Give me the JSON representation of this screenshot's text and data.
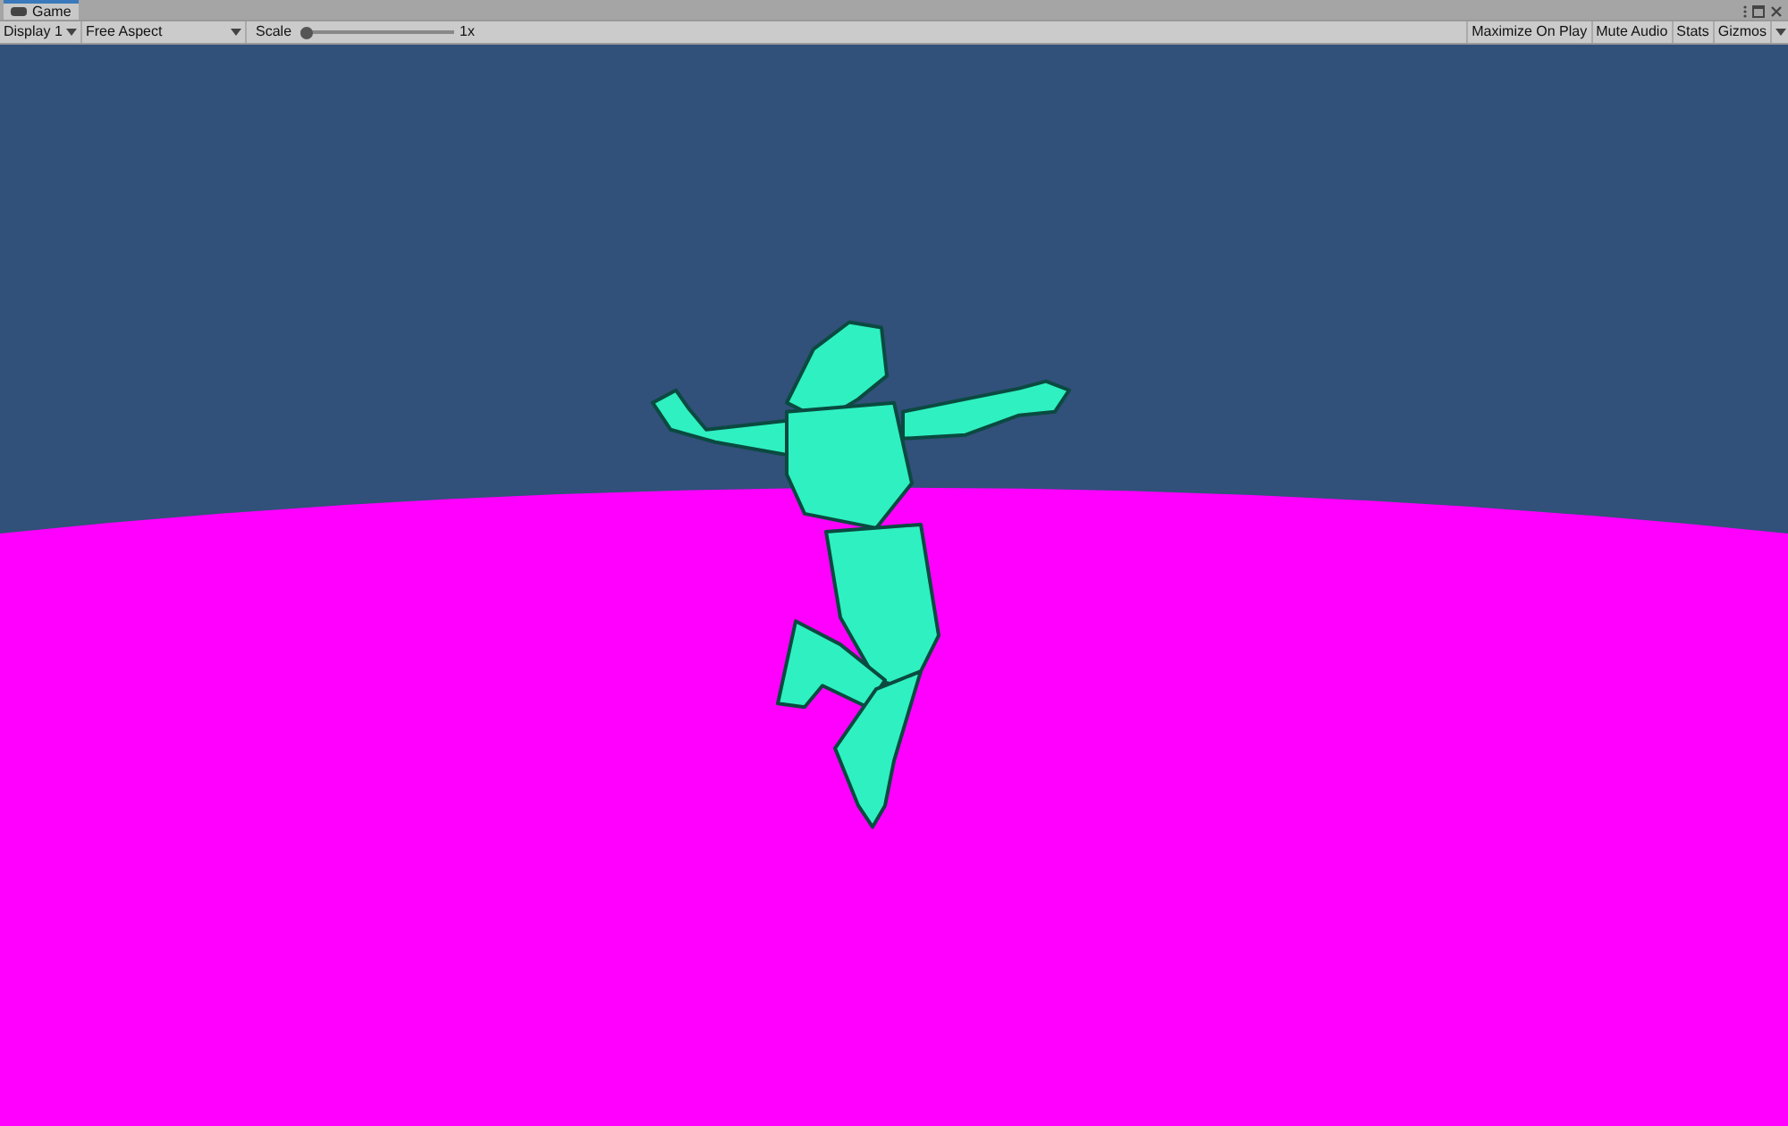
{
  "tab": {
    "label": "Game",
    "selected": true
  },
  "toolbar": {
    "display": "Display 1",
    "aspect": "Free Aspect",
    "scale": {
      "label": "Scale",
      "level": 0,
      "reading": "1x"
    },
    "toggles": [
      {
        "label": "Maximize On Play",
        "on": false
      },
      {
        "label": "Mute Audio",
        "on": false
      },
      {
        "label": "Stats",
        "on": false
      },
      {
        "label": "Gizmos",
        "on": false
      }
    ]
  }
}
